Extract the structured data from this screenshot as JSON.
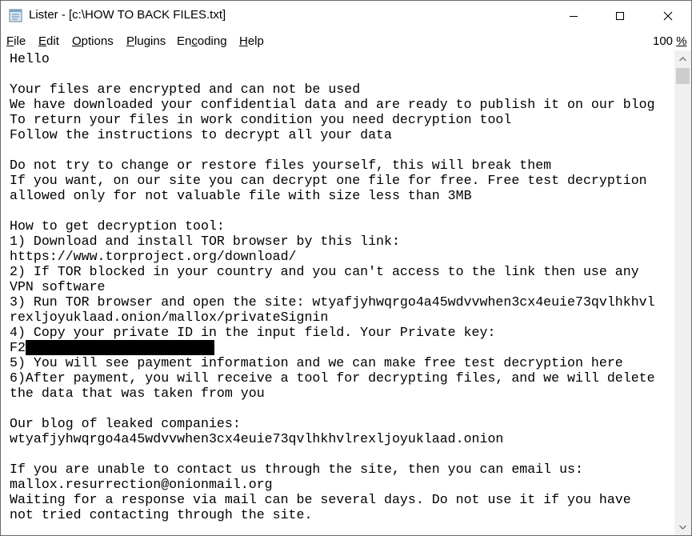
{
  "window": {
    "title": "Lister - [c:\\HOW TO BACK FILES.txt]",
    "icon": "notepad-icon"
  },
  "menu": {
    "items": [
      {
        "pre": "",
        "acc": "F",
        "post": "ile"
      },
      {
        "pre": "",
        "acc": "E",
        "post": "dit"
      },
      {
        "pre": "",
        "acc": "O",
        "post": "ptions"
      },
      {
        "pre": "",
        "acc": "P",
        "post": "lugins"
      },
      {
        "pre": "En",
        "acc": "c",
        "post": "oding"
      },
      {
        "pre": "",
        "acc": "H",
        "post": "elp"
      }
    ],
    "zoom_value": "100 ",
    "zoom_unit": "%"
  },
  "content": {
    "lines": [
      "Hello",
      "",
      "Your files are encrypted and can not be used",
      "We have downloaded your confidential data and are ready to publish it on our blog",
      "To return your files in work condition you need decryption tool",
      "Follow the instructions to decrypt all your data",
      "",
      "Do not try to change or restore files yourself, this will break them",
      "If you want, on our site you can decrypt one file for free. Free test decryption",
      "allowed only for not valuable file with size less than 3MB",
      "",
      "How to get decryption tool:",
      "1) Download and install TOR browser by this link:",
      "https://www.torproject.org/download/",
      "2) If TOR blocked in your country and you can't access to the link then use any",
      "VPN software",
      "3) Run TOR browser and open the site: wtyafjyhwqrgo4a45wdvvwhen3cx4euie73qvlhkhvl",
      "rexljoyuklaad.onion/mallox/privateSignin",
      "4) Copy your private ID in the input field. Your Private key:",
      "F2",
      "5) You will see payment information and we can make free test decryption here",
      "6)After payment, you will receive a tool for decrypting files, and we will delete",
      "the data that was taken from you",
      "",
      "Our blog of leaked companies:",
      "wtyafjyhwqrgo4a45wdvvwhen3cx4euie73qvlhkhvlrexljoyuklaad.onion",
      "",
      "If you are unable to contact us through the site, then you can email us:",
      "mallox.resurrection@onionmail.org",
      "Waiting for a response via mail can be several days. Do not use it if you have",
      "not tried contacting through the site."
    ],
    "redacted_line_index": 19
  },
  "colors": {
    "background": "#ffffff",
    "text": "#000000",
    "scrollbar_track": "#f0f0f0",
    "scrollbar_thumb": "#cdcdcd",
    "redaction": "#000000"
  }
}
